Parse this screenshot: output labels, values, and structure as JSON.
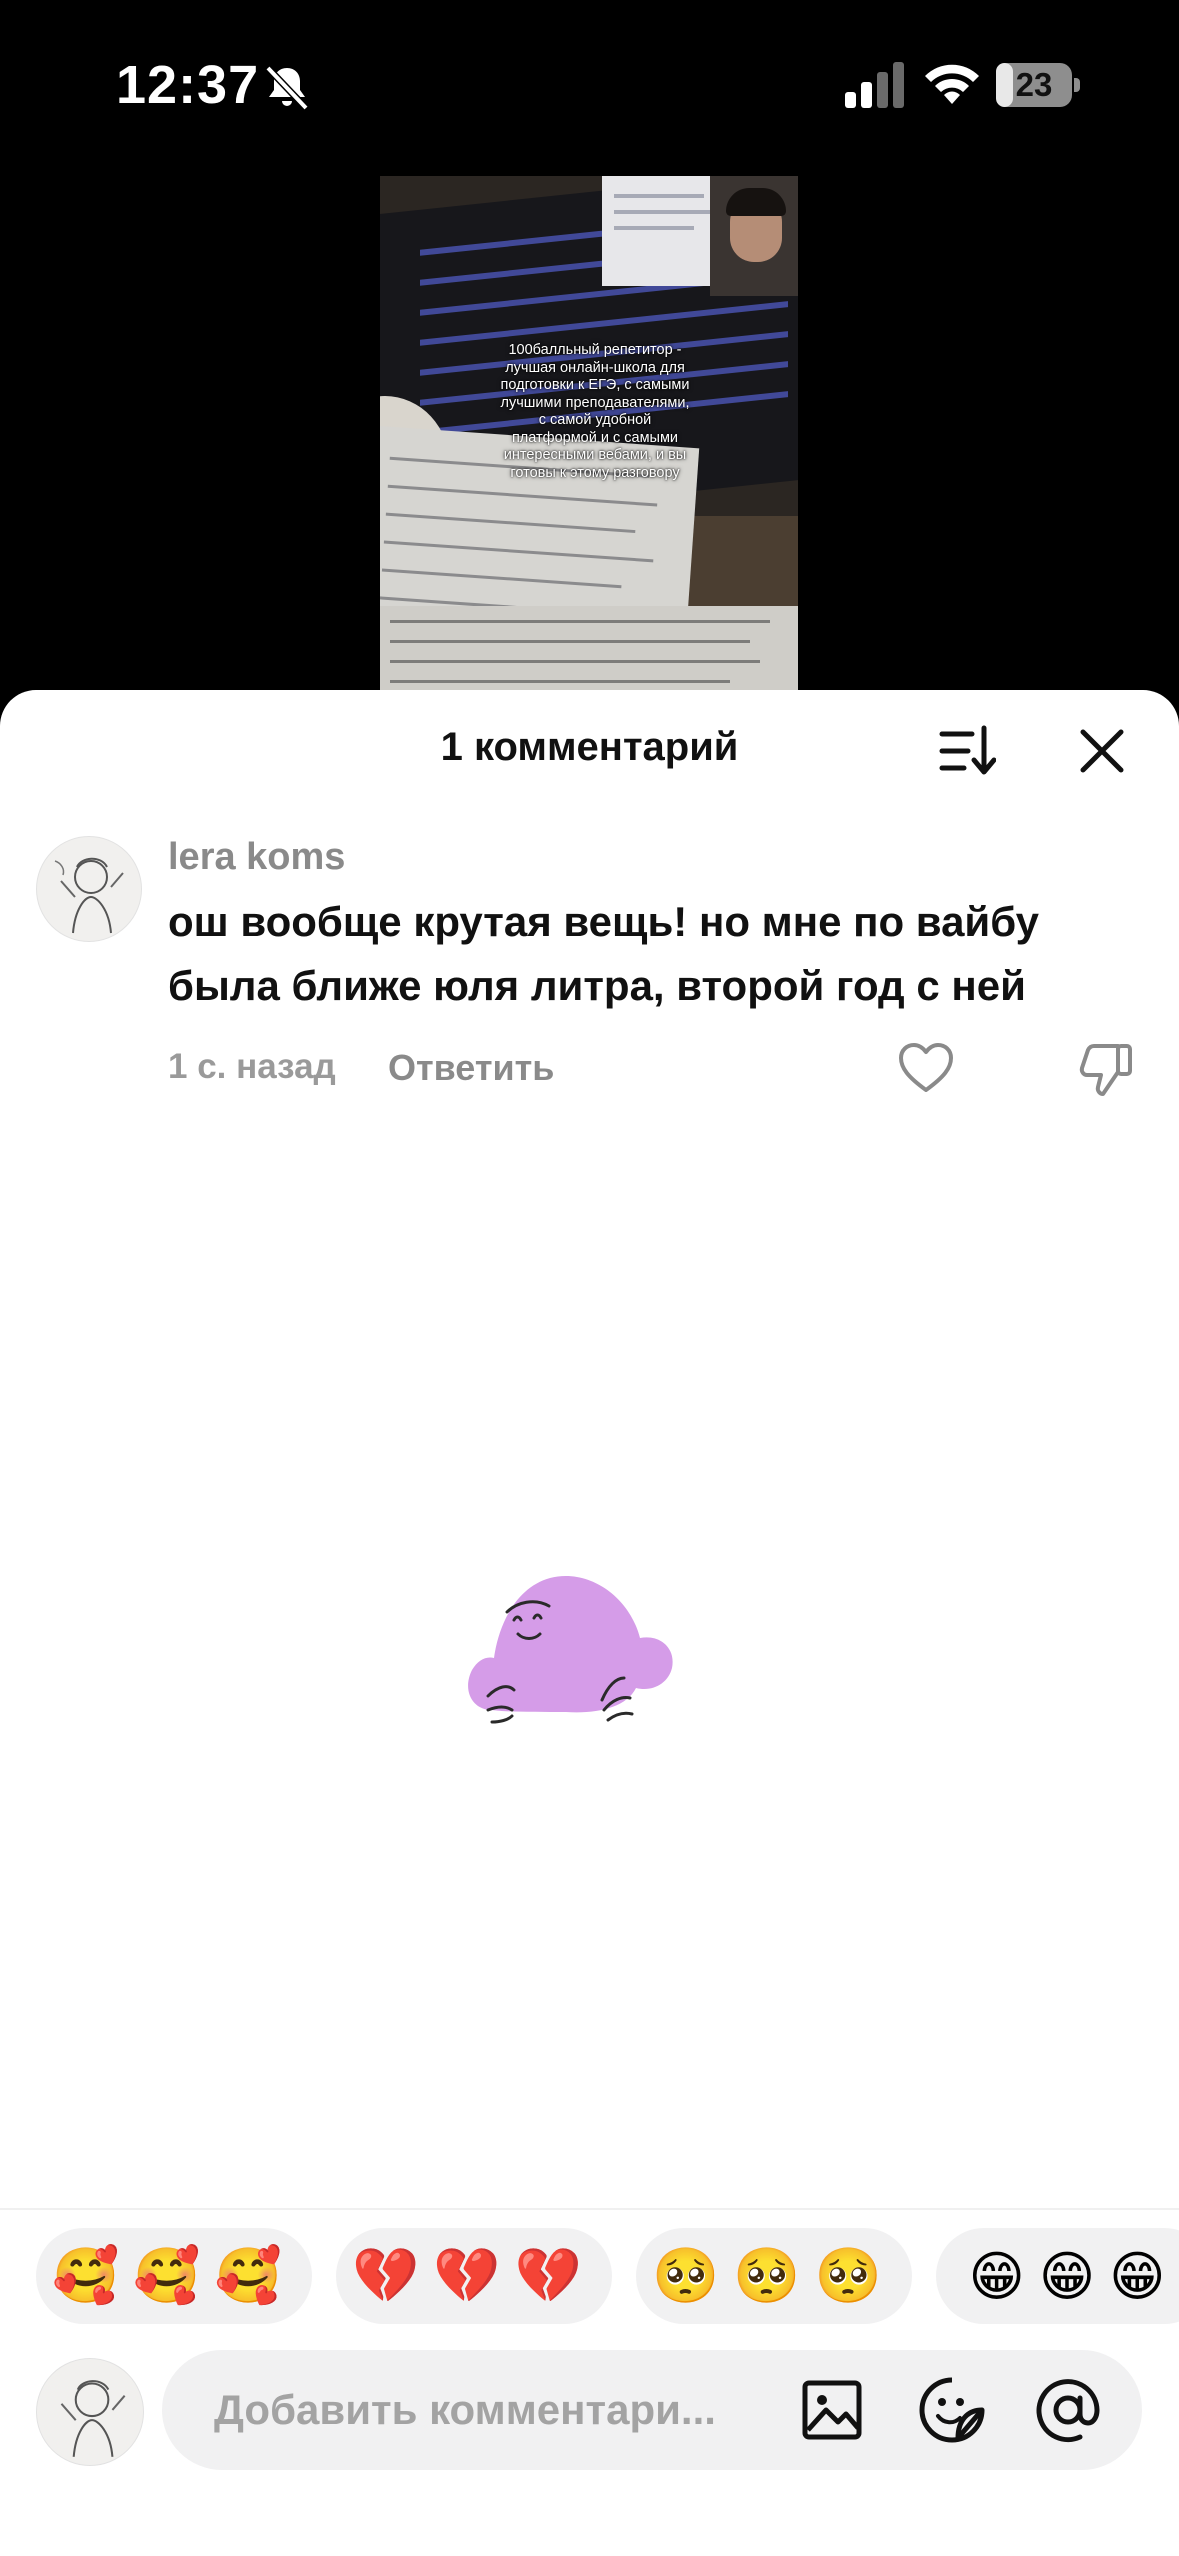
{
  "status_bar": {
    "time": "12:37",
    "battery_level": "23",
    "icons": [
      "bell-off-icon",
      "cellular-signal-icon",
      "wifi-icon",
      "battery-icon"
    ]
  },
  "video": {
    "caption": "100балльный репетитор - лучшая онлайн-школа для подготовки к ЕГЭ, с самыми лучшими преподавателями, с самой удобной платформой и с самыми интересными вебами, и вы готовы к этому разговору"
  },
  "comments_panel": {
    "title": "1 комментарий",
    "icons": [
      "sort-icon",
      "close-icon"
    ],
    "comments": [
      {
        "username": "lera koms",
        "text": "ош вообще крутая вещь! но мне по вайбу была ближе юля литра, второй год с ней",
        "time": "1 с. назад",
        "reply_label": "Ответить"
      }
    ]
  },
  "emoji_suggestions": [
    "🥰🥰🥰",
    "💔💔💔",
    "🥺🥺🥺",
    "😁😁😁"
  ],
  "composer": {
    "placeholder": "Добавить комментари...",
    "icons": [
      "image-icon",
      "sticker-icon",
      "mention-icon"
    ]
  },
  "colors": {
    "background": "#000000",
    "sheet": "#ffffff",
    "muted_text": "#8a8a8a",
    "chip": "#f1f1f2",
    "mascot": "#d59ce8"
  }
}
